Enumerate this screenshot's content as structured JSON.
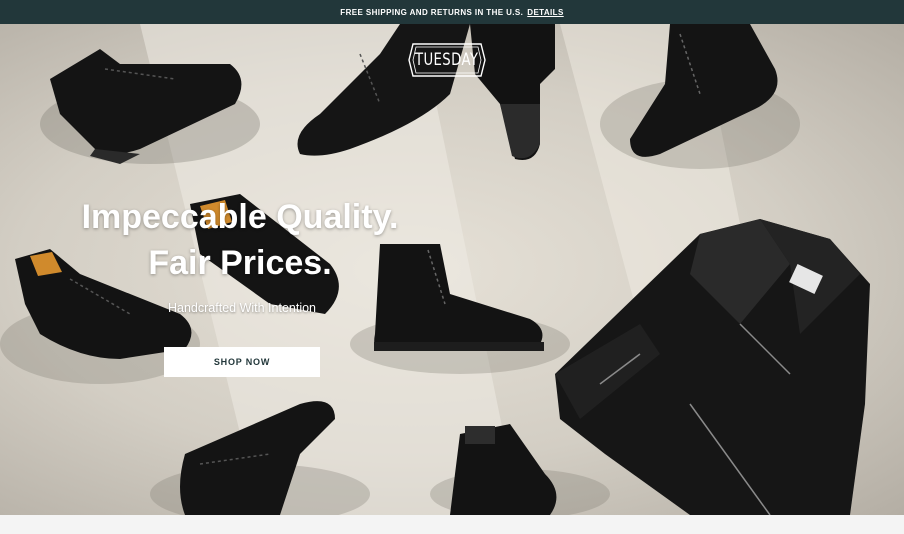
{
  "announcement": {
    "message": "FREE SHIPPING AND RETURNS IN THE U.S.",
    "link_label": "DETAILS"
  },
  "brand": {
    "logo_text": "TUESDAY"
  },
  "hero": {
    "headline_line1": "Impeccable Quality.",
    "headline_line2": "Fair Prices.",
    "subheadline": "Handcrafted With Intention",
    "cta_label": "SHOP NOW"
  },
  "colors": {
    "announcement_bg": "#22373a",
    "cta_text": "#22373a",
    "floor": "#d8d3c9",
    "leather": "#141414"
  }
}
